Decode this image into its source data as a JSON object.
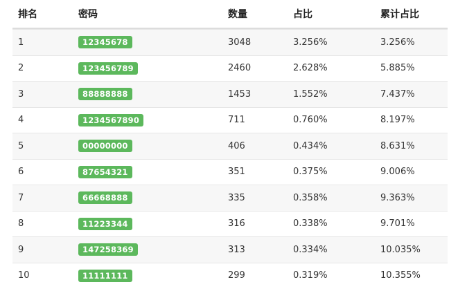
{
  "table": {
    "headers": {
      "rank": "排名",
      "password": "密码",
      "count": "数量",
      "ratio": "占比",
      "cumulative": "累计占比"
    },
    "rows": [
      {
        "rank": "1",
        "password": "12345678",
        "count": "3048",
        "ratio": "3.256%",
        "cumulative": "3.256%"
      },
      {
        "rank": "2",
        "password": "123456789",
        "count": "2460",
        "ratio": "2.628%",
        "cumulative": "5.885%"
      },
      {
        "rank": "3",
        "password": "88888888",
        "count": "1453",
        "ratio": "1.552%",
        "cumulative": "7.437%"
      },
      {
        "rank": "4",
        "password": "1234567890",
        "count": "711",
        "ratio": "0.760%",
        "cumulative": "8.197%"
      },
      {
        "rank": "5",
        "password": "00000000",
        "count": "406",
        "ratio": "0.434%",
        "cumulative": "8.631%"
      },
      {
        "rank": "6",
        "password": "87654321",
        "count": "351",
        "ratio": "0.375%",
        "cumulative": "9.006%"
      },
      {
        "rank": "7",
        "password": "66668888",
        "count": "335",
        "ratio": "0.358%",
        "cumulative": "9.363%"
      },
      {
        "rank": "8",
        "password": "11223344",
        "count": "316",
        "ratio": "0.338%",
        "cumulative": "9.701%"
      },
      {
        "rank": "9",
        "password": "147258369",
        "count": "313",
        "ratio": "0.334%",
        "cumulative": "10.035%"
      },
      {
        "rank": "10",
        "password": "11111111",
        "count": "299",
        "ratio": "0.319%",
        "cumulative": "10.355%"
      }
    ]
  },
  "colors": {
    "badge": "#5cb85c",
    "stripe": "#f7f7f7"
  }
}
